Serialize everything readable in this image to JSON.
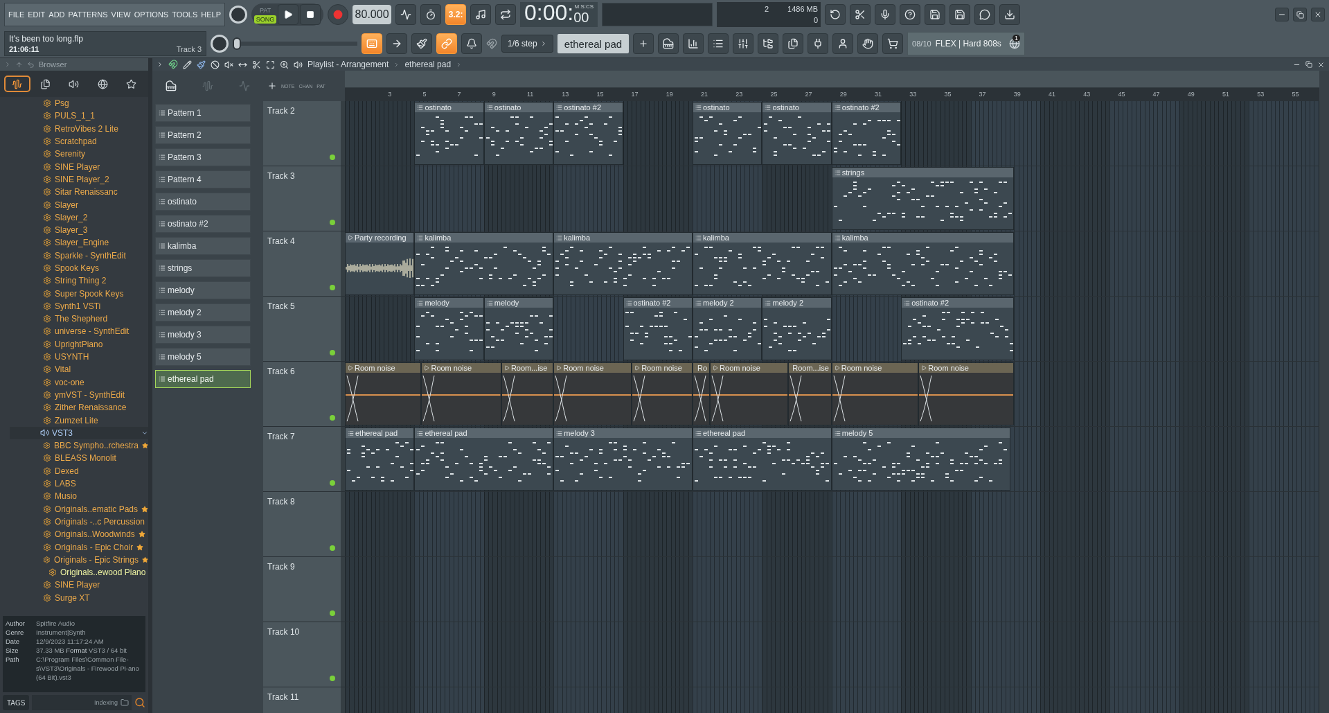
{
  "menu": [
    "FILE",
    "EDIT",
    "ADD",
    "PATTERNS",
    "VIEW",
    "OPTIONS",
    "TOOLS",
    "HELP"
  ],
  "transport": {
    "pat": "PAT",
    "song": "SONG",
    "song_selected": true,
    "tempo": "80.000"
  },
  "song_info": {
    "file": "It's been too long.flp",
    "time": "21:06:11",
    "track": "Track 3"
  },
  "song_position": {
    "level": 0
  },
  "tools_top": [
    {
      "kind": "tuner",
      "on": false
    },
    {
      "kind": "wait",
      "on": false
    },
    {
      "kind": "countdown",
      "on": true,
      "text": "3.2:"
    },
    {
      "kind": "stepedit",
      "on": false
    },
    {
      "kind": "looprec",
      "on": false
    }
  ],
  "tools_bottom": [
    {
      "kind": "typing",
      "on": true
    },
    {
      "kind": "arrow",
      "on": false
    },
    {
      "kind": "stroke",
      "on": false
    },
    {
      "kind": "link",
      "on": true
    },
    {
      "kind": "metronome",
      "on": false
    }
  ],
  "time": {
    "main": "0:00:",
    "sub": "00",
    "unit": "M:S:CS"
  },
  "cpu": {
    "voices": "2",
    "memory": "1486 MB",
    "polyphony": "0"
  },
  "snap": "1/6 step",
  "pattern_selector": "ethereal pad",
  "news": {
    "count": "08/10",
    "text": "FLEX | Hard 808s",
    "badge": "1"
  },
  "browser": {
    "title": "Browser",
    "tabs": [
      {
        "kind": "wave",
        "selected": true
      },
      {
        "kind": "files",
        "selected": false
      },
      {
        "kind": "speaker",
        "selected": false
      },
      {
        "kind": "globe",
        "selected": false
      },
      {
        "kind": "star",
        "selected": false
      }
    ],
    "items": [
      {
        "label": "Psg"
      },
      {
        "label": "PULS_1_1"
      },
      {
        "label": "RetroVibes 2 Lite"
      },
      {
        "label": "Scratchpad"
      },
      {
        "label": "Serenity"
      },
      {
        "label": "SINE Player"
      },
      {
        "label": "SINE Player_2"
      },
      {
        "label": "Sitar Renaissanc"
      },
      {
        "label": "Slayer"
      },
      {
        "label": "Slayer_2"
      },
      {
        "label": "Slayer_3"
      },
      {
        "label": "Slayer_Engine"
      },
      {
        "label": "Sparkle - SynthEdit"
      },
      {
        "label": "Spook Keys"
      },
      {
        "label": "String Thing 2"
      },
      {
        "label": "Super Spook Keys"
      },
      {
        "label": "Synth1 VSTi"
      },
      {
        "label": "The Shepherd"
      },
      {
        "label": "universe - SynthEdit"
      },
      {
        "label": "UprightPiano"
      },
      {
        "label": "USYNTH"
      },
      {
        "label": "Vital"
      },
      {
        "label": "voc-one"
      },
      {
        "label": "ymVST - SynthEdit"
      },
      {
        "label": "Zither Renaissance"
      },
      {
        "label": "Zumzet Lite"
      }
    ],
    "folder": {
      "label": "VST3",
      "expanded": true,
      "children": [
        {
          "label": "BBC Sympho..rchestra",
          "starred": true,
          "selected": false
        },
        {
          "label": "BLEASS Monolit",
          "starred": false,
          "selected": false
        },
        {
          "label": "Dexed",
          "starred": false,
          "selected": false
        },
        {
          "label": "LABS",
          "starred": false,
          "selected": false
        },
        {
          "label": "Musio",
          "starred": false,
          "selected": false
        },
        {
          "label": "Originals..ematic Pads",
          "starred": true,
          "selected": false
        },
        {
          "label": "Originals -..c Percussion",
          "starred": false,
          "selected": false
        },
        {
          "label": "Originals..Woodwinds",
          "starred": true,
          "selected": false
        },
        {
          "label": "Originals - Epic Choir",
          "starred": true,
          "selected": false
        },
        {
          "label": "Originals - Epic Strings",
          "starred": true,
          "selected": false
        },
        {
          "label": "Originals..ewood Piano",
          "starred": false,
          "selected": true
        },
        {
          "label": "SINE Player",
          "starred": false,
          "selected": false
        },
        {
          "label": "Surge XT",
          "starred": false,
          "selected": false
        }
      ]
    },
    "info": [
      {
        "key": "Author",
        "value": "Spitfire Audio"
      },
      {
        "key": "Genre",
        "value": "Instrument|Synth"
      },
      {
        "key": "Date",
        "value": "12/9/2023 11:17:24 AM"
      },
      {
        "key": "Size",
        "value": "37.33 MB",
        "extra_key": "Format",
        "extra_value": "VST3 / 64 bit"
      },
      {
        "key": "Path",
        "value": "C:\\Program Files\\Common File-s\\VST3\\Originals - Firewood Pi-ano (64 Bit).vst3"
      }
    ],
    "tags": "TAGS",
    "search_placeholder": "Indexing"
  },
  "playlist": {
    "title": "Playlist - Arrangement",
    "pattern": "ethereal pad",
    "modes": [
      "NOTE",
      "CHAN",
      "PAT"
    ],
    "ruler": [
      "3",
      "5",
      "7",
      "9",
      "11",
      "13",
      "15",
      "17",
      "19",
      "21",
      "23",
      "25",
      "27",
      "29",
      "31",
      "33",
      "35",
      "37",
      "39",
      "41",
      "43",
      "45",
      "47",
      "49",
      "51",
      "53",
      "55"
    ],
    "patterns": [
      {
        "label": "Pattern 1",
        "selected": false
      },
      {
        "label": "Pattern 2",
        "selected": false
      },
      {
        "label": "Pattern 3",
        "selected": false
      },
      {
        "label": "Pattern 4",
        "selected": false
      },
      {
        "label": "ostinato",
        "selected": false
      },
      {
        "label": "ostinato #2",
        "selected": false
      },
      {
        "label": "kalimba",
        "selected": false
      },
      {
        "label": "strings",
        "selected": false
      },
      {
        "label": "melody",
        "selected": false
      },
      {
        "label": "melody 2",
        "selected": false
      },
      {
        "label": "melody 3",
        "selected": false
      },
      {
        "label": "melody 5",
        "selected": false
      },
      {
        "label": "ethereal pad",
        "selected": true
      }
    ],
    "tracks": [
      {
        "name": "Track 2",
        "clips": [
          {
            "label": "ostinato",
            "kind": "pattern"
          },
          {
            "label": "ostinato",
            "kind": "pattern"
          },
          {
            "label": "ostinato #2",
            "kind": "pattern"
          },
          {
            "label": "ostinato",
            "kind": "pattern"
          },
          {
            "label": "ostinato",
            "kind": "pattern"
          },
          {
            "label": "ostinato #2",
            "kind": "pattern"
          }
        ]
      },
      {
        "name": "Track 3",
        "clips": [
          {
            "label": "strings",
            "kind": "pattern"
          }
        ]
      },
      {
        "name": "Track 4",
        "clips": [
          {
            "label": "Party recording",
            "kind": "audio"
          },
          {
            "label": "kalimba",
            "kind": "pattern"
          },
          {
            "label": "kalimba",
            "kind": "pattern"
          },
          {
            "label": "kalimba",
            "kind": "pattern"
          },
          {
            "label": "kalimba",
            "kind": "pattern"
          }
        ]
      },
      {
        "name": "Track 5",
        "clips": [
          {
            "label": "melody",
            "kind": "pattern"
          },
          {
            "label": "melody",
            "kind": "pattern"
          },
          {
            "label": "ostinato #2",
            "kind": "pattern"
          },
          {
            "label": "melody 2",
            "kind": "pattern"
          },
          {
            "label": "melody 2",
            "kind": "pattern"
          },
          {
            "label": "ostinato #2",
            "kind": "pattern"
          }
        ]
      },
      {
        "name": "Track 6",
        "clips": [
          {
            "label": "Room noise",
            "kind": "noise"
          },
          {
            "label": "Room noise",
            "kind": "noise"
          },
          {
            "label": "Room...ise",
            "kind": "noise"
          },
          {
            "label": "Room noise",
            "kind": "noise"
          },
          {
            "label": "Room noise",
            "kind": "noise"
          },
          {
            "label": "Ro",
            "kind": "noise"
          },
          {
            "label": "Room noise",
            "kind": "noise"
          },
          {
            "label": "Room...ise",
            "kind": "noise"
          },
          {
            "label": "Room noise",
            "kind": "noise"
          },
          {
            "label": "Room noise",
            "kind": "noise"
          }
        ]
      },
      {
        "name": "Track 7",
        "clips": [
          {
            "label": "ethereal pad",
            "kind": "pattern"
          },
          {
            "label": "ethereal pad",
            "kind": "pattern"
          },
          {
            "label": "melody 3",
            "kind": "pattern"
          },
          {
            "label": "ethereal pad",
            "kind": "pattern"
          },
          {
            "label": "melody 5",
            "kind": "pattern"
          }
        ]
      },
      {
        "name": "Track 8"
      },
      {
        "name": "Track 9"
      },
      {
        "name": "Track 10"
      },
      {
        "name": "Track 11"
      }
    ]
  }
}
